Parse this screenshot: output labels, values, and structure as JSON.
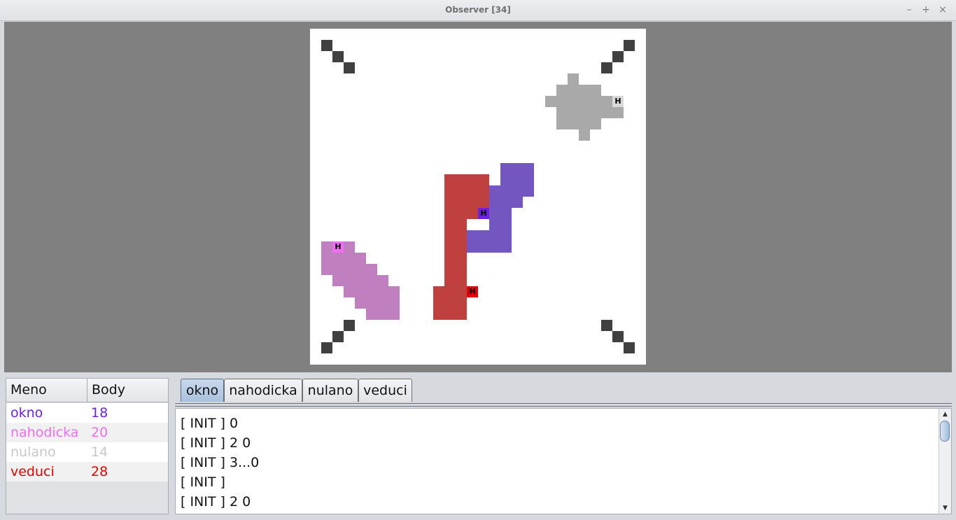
{
  "window": {
    "title": "Observer [34]",
    "controls": {
      "minimize": "–",
      "maximize": "+",
      "close": "×"
    }
  },
  "score_table": {
    "headers": {
      "name": "Meno",
      "score": "Body"
    },
    "rows": [
      {
        "name": "okno",
        "score": "18",
        "color": "#6a22e0"
      },
      {
        "name": "nahodicka",
        "score": "20",
        "color": "#f06cf0"
      },
      {
        "name": "nulano",
        "score": "14",
        "color": "#c8c8c8"
      },
      {
        "name": "veduci",
        "score": "28",
        "color": "#e00000"
      }
    ]
  },
  "tabs": [
    {
      "label": "okno",
      "active": true
    },
    {
      "label": "nahodicka",
      "active": false
    },
    {
      "label": "nulano",
      "active": false
    },
    {
      "label": "veduci",
      "active": false
    }
  ],
  "log": [
    "[ INIT ] 0",
    "[ INIT ] 2 0",
    "[ INIT ] 3...0",
    "[ INIT ]",
    "[ INIT ] 2 0"
  ],
  "arena": {
    "colors": {
      "obstacle": "#404040",
      "okno_body": "#7456c0",
      "okno_head": "#6a22e0",
      "nahodicka_body": "#c080c0",
      "nahodicka_head": "#f06cf0",
      "nulano_body": "#a9a9a9",
      "nulano_head": "#d9d9d9",
      "veduci_body": "#c04040",
      "veduci_head": "#e00000"
    },
    "head_label": "H",
    "icons": {
      "minimize": "minimize-icon",
      "maximize": "maximize-icon",
      "close": "close-icon",
      "scroll_up": "scroll-up-arrow-icon",
      "scroll_down": "scroll-down-arrow-icon"
    }
  }
}
